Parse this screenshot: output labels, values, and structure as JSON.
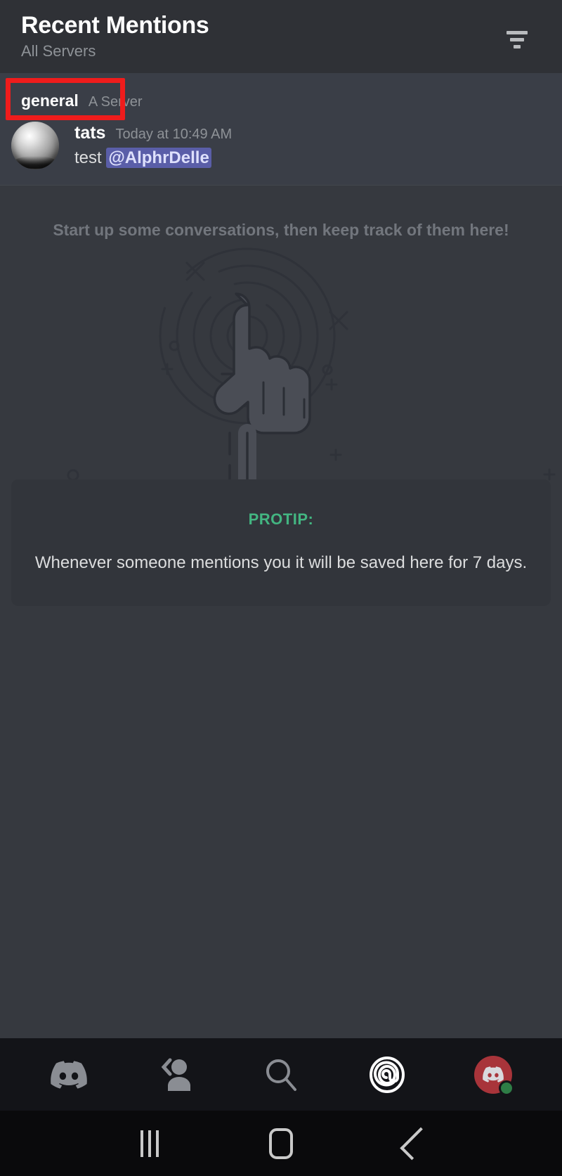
{
  "header": {
    "title": "Recent Mentions",
    "subtitle": "All Servers",
    "filter_icon": "filter-icon"
  },
  "mention": {
    "channel": "general",
    "server": "A Server",
    "author": "tats",
    "timestamp": "Today at 10:49 AM",
    "message_text": "test ",
    "mention_token": "@AlphrDelle",
    "avatar_icon": "user-avatar"
  },
  "empty_state": {
    "message": "Start up some conversations, then keep track of them here!",
    "illustration_icon": "pointing-hand-ripple-illustration"
  },
  "protip": {
    "label": "PROTIP:",
    "text": "Whenever someone mentions you it will be saved here for 7 days.",
    "label_color": "#43b581"
  },
  "bottom_nav": {
    "items": [
      {
        "icon": "discord-servers-icon",
        "active": false
      },
      {
        "icon": "friends-icon",
        "active": false
      },
      {
        "icon": "search-icon",
        "active": false
      },
      {
        "icon": "mentions-at-icon",
        "active": true
      },
      {
        "icon": "user-profile-avatar-icon",
        "active": false
      }
    ]
  },
  "system_nav": {
    "recents_icon": "recents-icon",
    "home_icon": "home-icon",
    "back_icon": "back-icon"
  },
  "annotation": {
    "color": "#ef1c1c",
    "target": "general-channel-label"
  },
  "theme": {
    "background": "#36393f",
    "header_background": "#2f3136",
    "card_background": "#32353b",
    "nav_background": "#131418",
    "accent_green": "#43b581",
    "mention_pill": "#5a5ea8"
  }
}
